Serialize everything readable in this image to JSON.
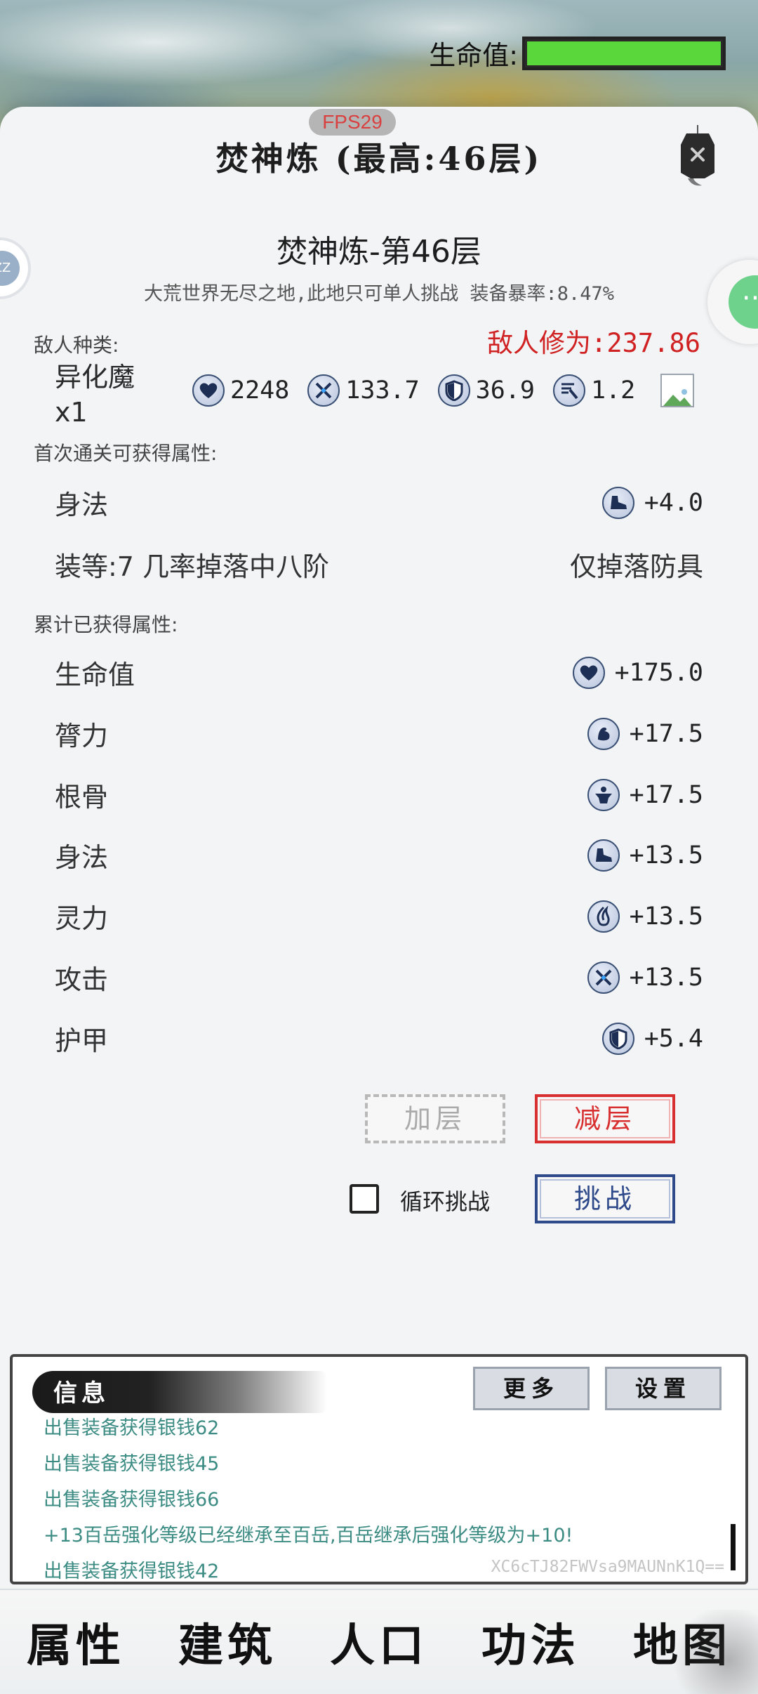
{
  "header": {
    "hp_label": "生命值:",
    "hp_fraction": 1.0,
    "hp_color": "#5ad83b"
  },
  "fps": "FPS29",
  "main_title": "焚神炼 (最高:46层)",
  "side_left_badge": "ZZ",
  "floor": {
    "title": "焚神炼-第46层",
    "subtitle": "大荒世界无尽之地,此地只可单人挑战 装备暴率:8.47%"
  },
  "enemy": {
    "section_label": "敌人种类:",
    "power": "敌人修为:237.86",
    "name": "异化魔",
    "count": "x1",
    "stats": [
      {
        "icon": "heart-icon",
        "value": "2248"
      },
      {
        "icon": "sword-icon",
        "value": "133.7"
      },
      {
        "icon": "shield-icon",
        "value": "36.9"
      },
      {
        "icon": "speed-icon",
        "value": "1.2"
      }
    ]
  },
  "first_clear": {
    "section_label": "首次通关可获得属性:",
    "rows": [
      {
        "name": "身法",
        "icon": "boot-icon",
        "value": "+4.0"
      }
    ],
    "drop_left": "装等:7 几率掉落中八阶",
    "drop_right": "仅掉落防具"
  },
  "accumulated": {
    "section_label": "累计已获得属性:",
    "rows": [
      {
        "name": "生命值",
        "icon": "heart-icon",
        "value": "+175.0"
      },
      {
        "name": "膂力",
        "icon": "muscle-icon",
        "value": "+17.5"
      },
      {
        "name": "根骨",
        "icon": "body-icon",
        "value": "+17.5"
      },
      {
        "name": "身法",
        "icon": "boot-icon",
        "value": "+13.5"
      },
      {
        "name": "灵力",
        "icon": "spirit-icon",
        "value": "+13.5"
      },
      {
        "name": "攻击",
        "icon": "sword-icon",
        "value": "+13.5"
      },
      {
        "name": "护甲",
        "icon": "shield-icon",
        "value": "+5.4"
      }
    ]
  },
  "controls": {
    "add_floor": "加层",
    "sub_floor": "减层",
    "loop_label": "循环挑战",
    "challenge": "挑战"
  },
  "info": {
    "title": "信息",
    "more": "更多",
    "settings": "设置",
    "logs": [
      "出售装备获得银钱62",
      "出售装备获得银钱45",
      "出售装备获得银钱66",
      "+13百岳强化等级已经继承至百岳,百岳继承后强化等级为+10!",
      "出售装备获得银钱42"
    ],
    "id": "XC6cTJ82FWVsa9MAUNnK1Q=="
  },
  "nav": {
    "items": [
      "属性",
      "建筑",
      "人口",
      "功法",
      "地图"
    ]
  }
}
